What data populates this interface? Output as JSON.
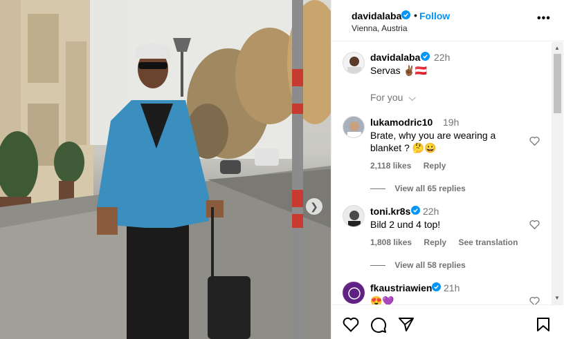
{
  "post": {
    "author": "davidalaba",
    "follow_label": "Follow",
    "separator": "•",
    "location": "Vienna, Austria",
    "more_label": "•••",
    "caption": {
      "username": "davidalaba",
      "time": "22h",
      "text": "Servas ✌🏾🇦🇹"
    },
    "for_you_label": "For you"
  },
  "comments": [
    {
      "username": "lukamodric10",
      "time": "19h",
      "text_line1": "Brate, why you are wearing a",
      "text_line2": "blanket ? 🤔😀",
      "likes": "2,118 likes",
      "reply": "Reply",
      "view_replies": "View all 65 replies"
    },
    {
      "username": "toni.kr8s",
      "time": "22h",
      "text_line1": "Bild 2 und 4 top!",
      "likes": "1,808 likes",
      "reply": "Reply",
      "see_translation": "See translation",
      "view_replies": "View all 58 replies"
    },
    {
      "username": "fkaustriawien",
      "time": "21h",
      "text_line1": "😍💜"
    }
  ],
  "icons": {
    "verified": "verified-badge-icon",
    "heart": "heart-icon",
    "comment": "comment-icon",
    "share": "share-icon",
    "save": "bookmark-icon",
    "next": "chevron-right-icon"
  },
  "colors": {
    "accent": "#0095f6",
    "muted": "#737373"
  }
}
